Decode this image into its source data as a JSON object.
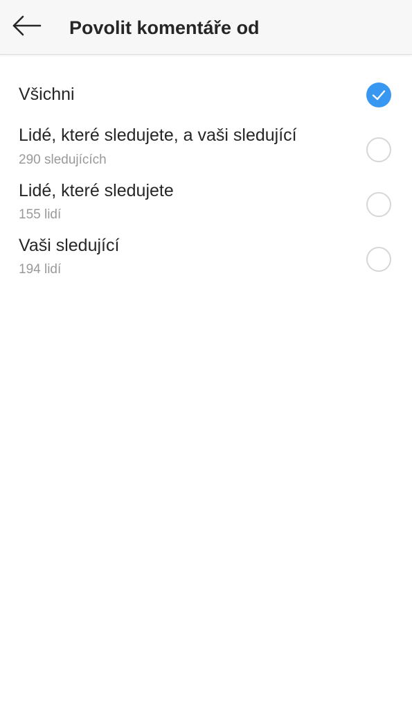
{
  "header": {
    "title": "Povolit komentáře od"
  },
  "options": [
    {
      "label": "Všichni",
      "sublabel": "",
      "selected": true
    },
    {
      "label": "Lidé, které sledujete, a vaši sledující",
      "sublabel": "290 sledujících",
      "selected": false
    },
    {
      "label": "Lidé, které sledujete",
      "sublabel": "155 lidí",
      "selected": false
    },
    {
      "label": "Vaši sledující",
      "sublabel": "194 lidí",
      "selected": false
    }
  ],
  "icons": {
    "back": "arrow-left-icon",
    "check": "checkmark-icon"
  },
  "colors": {
    "accent": "#3897f0",
    "text_primary": "#262626",
    "text_secondary": "#999999",
    "toolbar_bg": "#f7f7f7"
  }
}
